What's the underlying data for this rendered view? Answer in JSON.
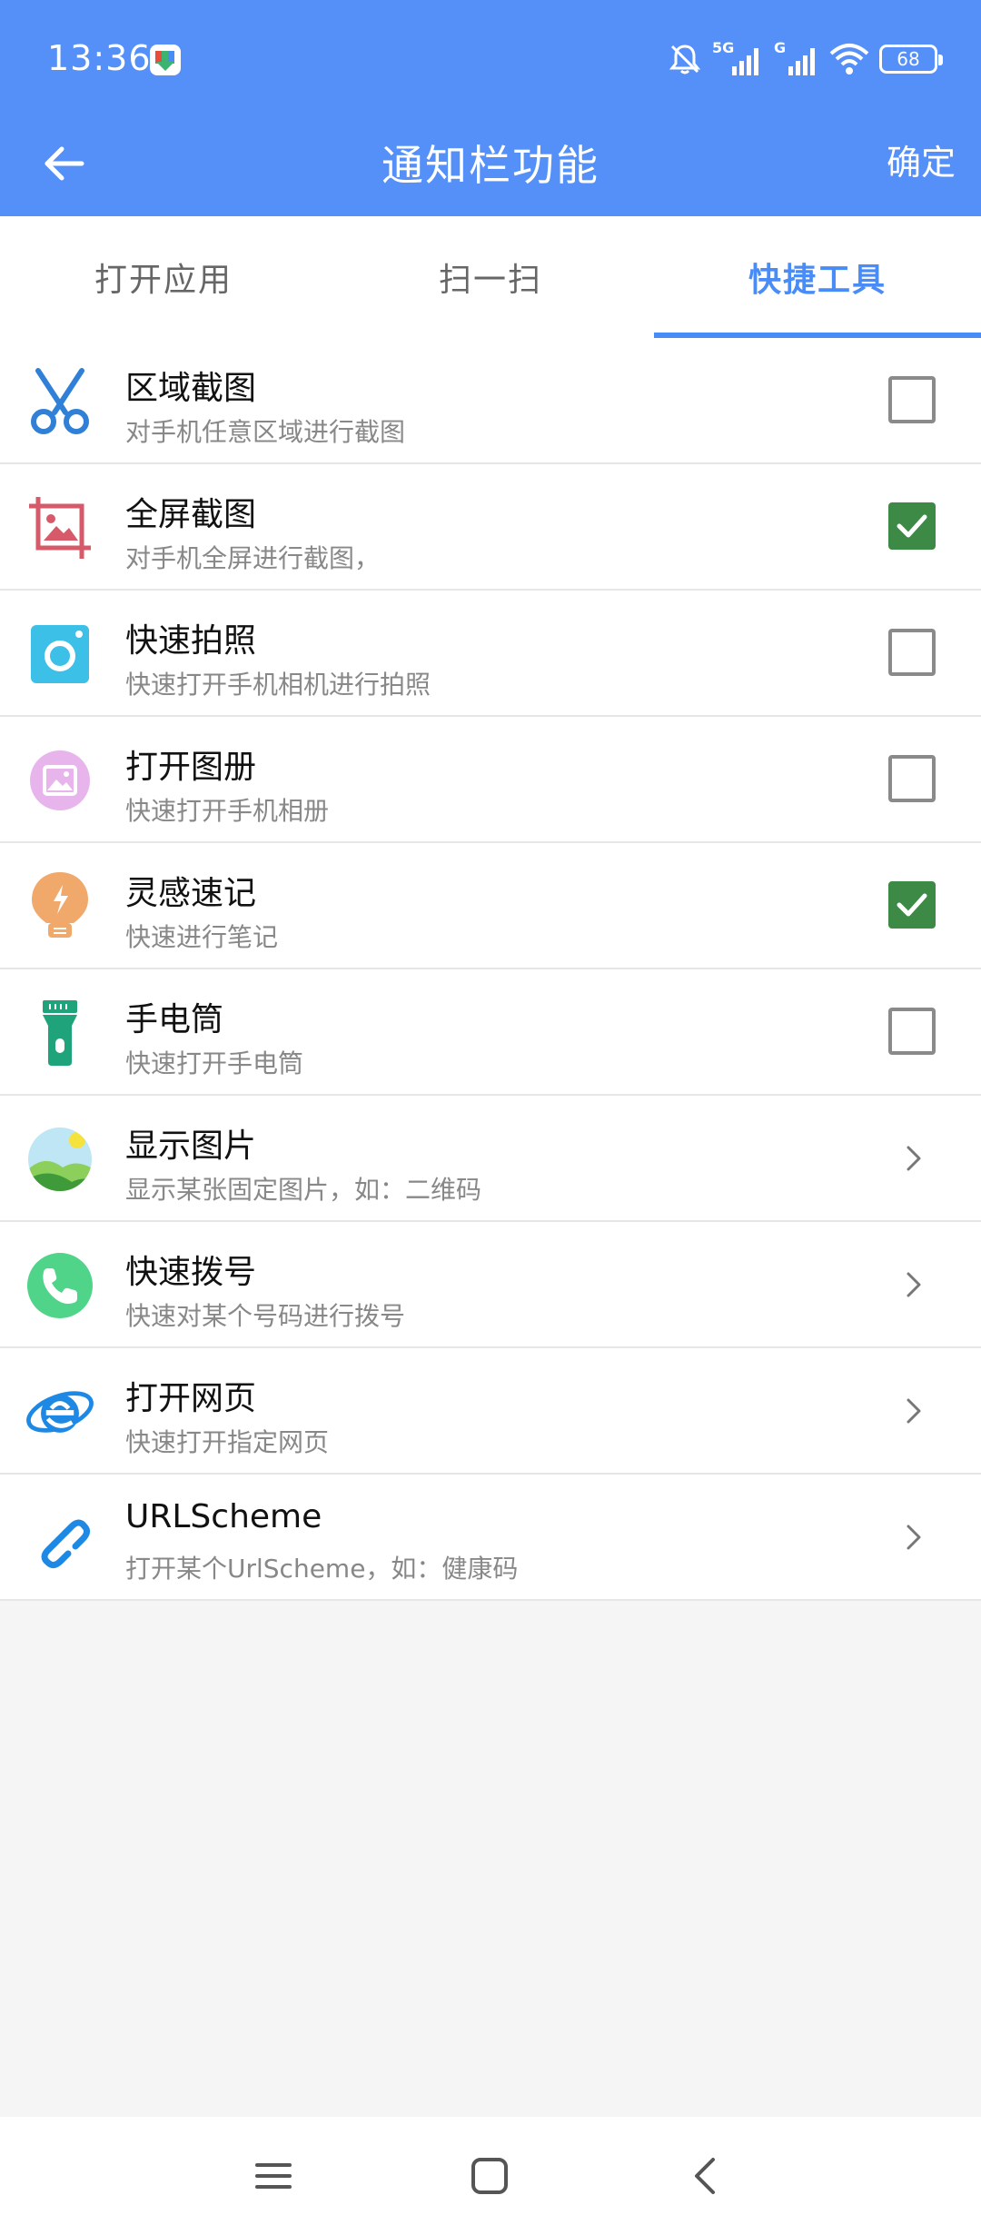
{
  "status_bar": {
    "time": "13:36",
    "network_5g": "5G",
    "network_g": "G",
    "battery": "68"
  },
  "titlebar": {
    "title": "通知栏功能",
    "confirm_label": "确定"
  },
  "tabs": [
    {
      "label": "打开应用",
      "active": false
    },
    {
      "label": "扫一扫",
      "active": false
    },
    {
      "label": "快捷工具",
      "active": true
    }
  ],
  "items": [
    {
      "title": "区域截图",
      "desc": "对手机任意区域进行截图",
      "icon": "scissors-icon",
      "control": "checkbox",
      "checked": false
    },
    {
      "title": "全屏截图",
      "desc": "对手机全屏进行截图，",
      "icon": "screenshot-icon",
      "control": "checkbox",
      "checked": true
    },
    {
      "title": "快速拍照",
      "desc": "快速打开手机相机进行拍照",
      "icon": "camera-icon",
      "control": "checkbox",
      "checked": false
    },
    {
      "title": "打开图册",
      "desc": "快速打开手机相册",
      "icon": "gallery-icon",
      "control": "checkbox",
      "checked": false
    },
    {
      "title": "灵感速记",
      "desc": "快速进行笔记",
      "icon": "lightbulb-icon",
      "control": "checkbox",
      "checked": true
    },
    {
      "title": "手电筒",
      "desc": "快速打开手电筒",
      "icon": "flashlight-icon",
      "control": "checkbox",
      "checked": false
    },
    {
      "title": "显示图片",
      "desc": "显示某张固定图片，如：二维码",
      "icon": "landscape-icon",
      "control": "chevron"
    },
    {
      "title": "快速拨号",
      "desc": "快速对某个号码进行拨号",
      "icon": "phone-icon",
      "control": "chevron"
    },
    {
      "title": "打开网页",
      "desc": "快速打开指定网页",
      "icon": "browser-icon",
      "control": "chevron"
    },
    {
      "title": "URLScheme",
      "desc": "打开某个UrlScheme，如：健康码",
      "icon": "link-icon",
      "control": "chevron"
    }
  ],
  "colors": {
    "header": "#5590f8",
    "accent": "#4a8cf6",
    "checked": "#3c8a46"
  }
}
